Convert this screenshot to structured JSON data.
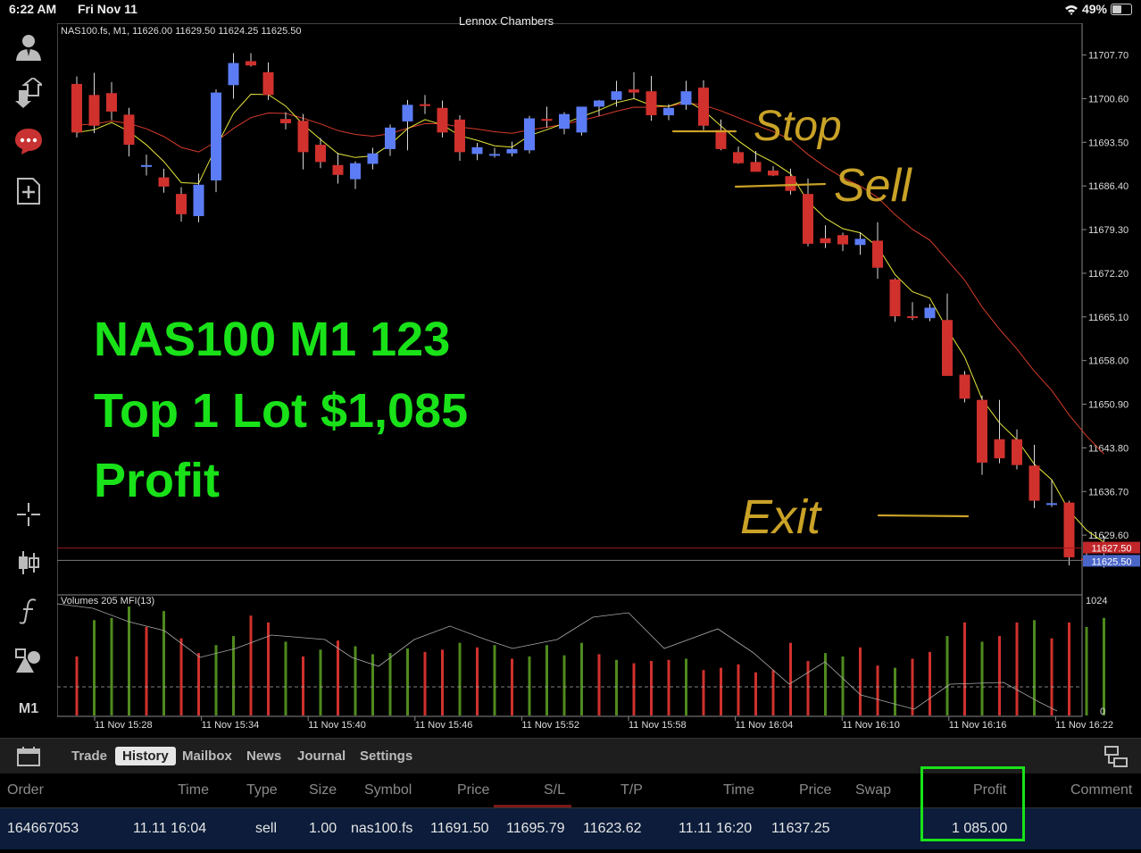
{
  "status_bar": {
    "time": "6:22 AM",
    "date": "Fri Nov 11",
    "owner": "Lennox Chambers",
    "battery": "49%",
    "battery_level": 0.49
  },
  "toolbar": {
    "timeframe_label": "M1",
    "icons": [
      "account-icon",
      "trade-transfer-icon",
      "chat-icon",
      "new-chart-icon",
      "crosshair-icon",
      "chart-type-icon",
      "indicator-icon",
      "objects-icon",
      "timeframe-icon"
    ]
  },
  "chart": {
    "header": "NAS100.fs, M1, 11626.00 11629.50 11624.25 11625.50",
    "price_ticks": [
      "11707.70",
      "11700.60",
      "11693.50",
      "11686.40",
      "11679.30",
      "11672.20",
      "11665.10",
      "11658.00",
      "11650.90",
      "11643.80",
      "11636.70",
      "11629.60"
    ],
    "ask_label": "11627.50",
    "bid_label": "11625.50",
    "volume_header": "Volumes 205 MFI(13)",
    "volume_max": "1024",
    "volume_min": "0",
    "time_ticks": [
      "11 Nov 15:28",
      "11 Nov 15:34",
      "11 Nov 15:40",
      "11 Nov 15:46",
      "11 Nov 15:52",
      "11 Nov 15:58",
      "11 Nov 16:04",
      "11 Nov 16:10",
      "11 Nov 16:16",
      "11 Nov 16:22"
    ],
    "overlay_text": [
      "NAS100 M1 123",
      "Top 1 Lot $1,085",
      "Profit"
    ],
    "annotations": [
      "Stop",
      "Sell",
      "Exit"
    ],
    "colors": {
      "bull": "#5b7cf5",
      "bear": "#d0312d",
      "fast_ma": "#e6e63a",
      "slow_ma": "#d63b2a",
      "overlay": "#19e219",
      "handwriting": "#c9a227",
      "vol_green": "#4f8a1e",
      "vol_red": "#d0312d"
    }
  },
  "chart_data": {
    "type": "candlestick",
    "symbol": "NAS100.fs",
    "timeframe": "M1",
    "ylim": [
      11622.5,
      11712.0
    ],
    "candles": [
      [
        11703.0,
        11704.2,
        11694.3,
        11695.1
      ],
      [
        11701.2,
        11704.8,
        11695.0,
        11696.2
      ],
      [
        11701.5,
        11703.3,
        11697.1,
        11698.5
      ],
      [
        11698.0,
        11699.1,
        11691.2,
        11693.1
      ],
      [
        11689.5,
        11691.5,
        11688.1,
        11689.8
      ],
      [
        11687.8,
        11689.2,
        11685.3,
        11686.3
      ],
      [
        11685.1,
        11686.2,
        11680.6,
        11681.8
      ],
      [
        11681.5,
        11688.4,
        11680.5,
        11686.6
      ],
      [
        11687.3,
        11702.1,
        11685.4,
        11701.6
      ],
      [
        11702.8,
        11708.0,
        11700.6,
        11706.4
      ],
      [
        11706.7,
        11708.0,
        11705.8,
        11706.0
      ],
      [
        11704.9,
        11706.5,
        11700.4,
        11701.2
      ],
      [
        11697.3,
        11698.4,
        11695.6,
        11696.6
      ],
      [
        11697.0,
        11698.1,
        11689.1,
        11691.9
      ],
      [
        11693.1,
        11694.2,
        11689.3,
        11690.3
      ],
      [
        11689.8,
        11691.8,
        11686.8,
        11688.2
      ],
      [
        11687.5,
        11690.4,
        11685.9,
        11690.1
      ],
      [
        11690.0,
        11692.6,
        11689.1,
        11691.7
      ],
      [
        11692.4,
        11696.4,
        11691.3,
        11695.9
      ],
      [
        11696.9,
        11700.4,
        11692.2,
        11699.6
      ],
      [
        11699.7,
        11701.2,
        11698.1,
        11699.4
      ],
      [
        11699.1,
        11700.3,
        11694.3,
        11695.1
      ],
      [
        11697.2,
        11697.9,
        11690.5,
        11691.9
      ],
      [
        11691.6,
        11693.4,
        11690.6,
        11692.7
      ],
      [
        11691.4,
        11692.6,
        11691.0,
        11691.6
      ],
      [
        11691.7,
        11693.6,
        11691.2,
        11692.4
      ],
      [
        11692.2,
        11697.8,
        11691.7,
        11697.4
      ],
      [
        11697.3,
        11699.3,
        11695.9,
        11697.0
      ],
      [
        11695.7,
        11698.4,
        11694.8,
        11698.1
      ],
      [
        11695.1,
        11698.8,
        11694.6,
        11699.3
      ],
      [
        11699.3,
        11700.4,
        11697.8,
        11700.3
      ],
      [
        11700.4,
        11703.5,
        11699.3,
        11701.8
      ],
      [
        11702.1,
        11704.9,
        11700.6,
        11701.6
      ],
      [
        11701.8,
        11704.3,
        11697.0,
        11697.9
      ],
      [
        11697.9,
        11699.7,
        11697.1,
        11699.1
      ],
      [
        11699.6,
        11703.5,
        11698.8,
        11701.8
      ],
      [
        11702.4,
        11703.6,
        11695.5,
        11696.2
      ],
      [
        11695.5,
        11697.2,
        11692.2,
        11692.4
      ],
      [
        11691.9,
        11692.8,
        11690.0,
        11690.1
      ],
      [
        11690.3,
        11692.1,
        11688.8,
        11688.7
      ],
      [
        11688.9,
        11689.6,
        11688.0,
        11688.1
      ],
      [
        11688.0,
        11689.2,
        11685.0,
        11685.6
      ],
      [
        11685.1,
        11687.6,
        11676.6,
        11677.0
      ],
      [
        11677.9,
        11680.0,
        11676.3,
        11677.1
      ],
      [
        11678.4,
        11678.8,
        11675.8,
        11676.9
      ],
      [
        11676.8,
        11678.9,
        11675.2,
        11677.8
      ],
      [
        11677.5,
        11680.5,
        11671.3,
        11673.1
      ],
      [
        11671.2,
        11671.4,
        11664.3,
        11665.2
      ],
      [
        11665.2,
        11667.5,
        11664.6,
        11665.0
      ],
      [
        11664.9,
        11667.2,
        11664.4,
        11666.6
      ],
      [
        11664.6,
        11668.9,
        11655.9,
        11655.5
      ],
      [
        11655.7,
        11656.3,
        11651.2,
        11651.8
      ],
      [
        11651.6,
        11652.3,
        11639.4,
        11641.4
      ],
      [
        11645.2,
        11651.6,
        11641.3,
        11642.1
      ],
      [
        11645.2,
        11646.8,
        11640.3,
        11641.0
      ],
      [
        11640.9,
        11644.3,
        11634.0,
        11635.2
      ],
      [
        11634.6,
        11638.6,
        11634.2,
        11634.8
      ],
      [
        11634.9,
        11635.2,
        11624.7,
        11626.0
      ],
      [
        11625.8,
        11627.8,
        11625.1,
        11625.7
      ],
      [
        11626.0,
        11629.5,
        11624.3,
        11625.5
      ]
    ],
    "volume": [
      52,
      84,
      86,
      96,
      78,
      92,
      68,
      55,
      62,
      70,
      88,
      82,
      65,
      52,
      58,
      66,
      61,
      54,
      55,
      59,
      56,
      58,
      64,
      60,
      62,
      50,
      52,
      62,
      53,
      64,
      54,
      49,
      46,
      48,
      49,
      50,
      40,
      42,
      45,
      38,
      40,
      64,
      48,
      55,
      52,
      60,
      44,
      42,
      50,
      56,
      70,
      82,
      65,
      70,
      82,
      84,
      68,
      82,
      78,
      86
    ],
    "volume_bull": [
      false,
      true,
      true,
      true,
      false,
      true,
      false,
      false,
      true,
      true,
      false,
      false,
      true,
      false,
      true,
      false,
      true,
      true,
      true,
      true,
      false,
      false,
      true,
      false,
      true,
      false,
      true,
      true,
      true,
      true,
      false,
      true,
      false,
      false,
      false,
      true,
      false,
      false,
      false,
      false,
      false,
      false,
      false,
      true,
      true,
      false,
      false,
      true,
      false,
      false,
      true,
      false,
      true,
      false,
      false,
      true,
      false,
      false,
      true,
      true
    ],
    "moving_averages": [
      "fast MA (yellow)",
      "slow MA (red)"
    ]
  },
  "bottom_tabs": {
    "items": [
      "Trade",
      "History",
      "Mailbox",
      "News",
      "Journal",
      "Settings"
    ],
    "active": "History"
  },
  "history": {
    "columns": [
      "Order",
      "Time",
      "Type",
      "Size",
      "Symbol",
      "Price",
      "S/L",
      "T/P",
      "Time",
      "Price",
      "Swap",
      "Profit",
      "Comment"
    ],
    "rows": [
      {
        "order": "164667053",
        "open_time": "11.11 16:04",
        "type": "sell",
        "size": "1.00",
        "symbol": "nas100.fs",
        "open_price": "11691.50",
        "sl": "11695.79",
        "tp": "11623.62",
        "close_time": "11.11 16:20",
        "close_price": "11637.25",
        "swap": "",
        "profit": "1 085.00",
        "comment": ""
      }
    ]
  }
}
